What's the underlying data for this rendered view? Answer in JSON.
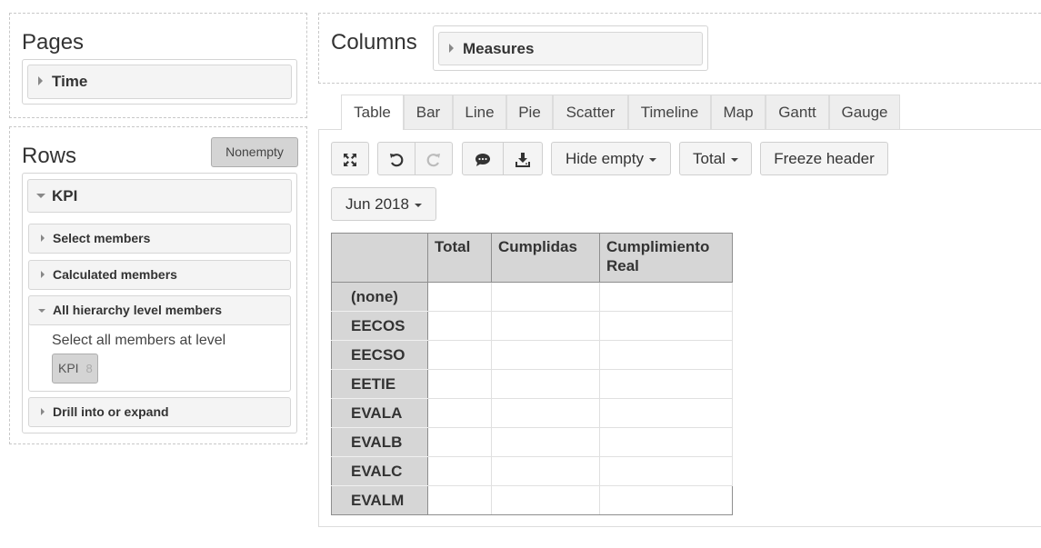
{
  "pages": {
    "title": "Pages",
    "dimensions": [
      {
        "label": "Time"
      }
    ]
  },
  "rows": {
    "title": "Rows",
    "nonempty_label": "Nonempty",
    "dimension": {
      "label": "KPI",
      "sections": [
        {
          "label": "Select members",
          "expanded": false
        },
        {
          "label": "Calculated members",
          "expanded": false
        },
        {
          "label": "All hierarchy level members",
          "expanded": true
        },
        {
          "label": "Drill into or expand",
          "expanded": false
        }
      ],
      "level_hint": "Select all members at level",
      "level_chip": {
        "label": "KPI",
        "count": "8"
      }
    }
  },
  "columns": {
    "title": "Columns",
    "dimensions": [
      {
        "label": "Measures"
      }
    ]
  },
  "tabs": [
    "Table",
    "Bar",
    "Line",
    "Pie",
    "Scatter",
    "Timeline",
    "Map",
    "Gantt",
    "Gauge"
  ],
  "active_tab": "Table",
  "toolbar": {
    "hide_empty": "Hide empty",
    "total": "Total",
    "freeze_header": "Freeze header",
    "period": "Jun 2018",
    "icons": [
      "fullscreen-icon",
      "undo-icon",
      "redo-icon",
      "comment-icon",
      "download-icon"
    ]
  },
  "table": {
    "headers": [
      "Total",
      "Cumplidas",
      "Cumplimiento Real"
    ],
    "row_labels": [
      "(none)",
      "EECOS",
      "EECSO",
      "EETIE",
      "EVALA",
      "EVALB",
      "EVALC",
      "EVALM"
    ]
  },
  "colors": {
    "header_bg": "#d6d6d6",
    "button_bg": "#f4f4f4",
    "nonempty_bg": "#d4d4d4"
  }
}
